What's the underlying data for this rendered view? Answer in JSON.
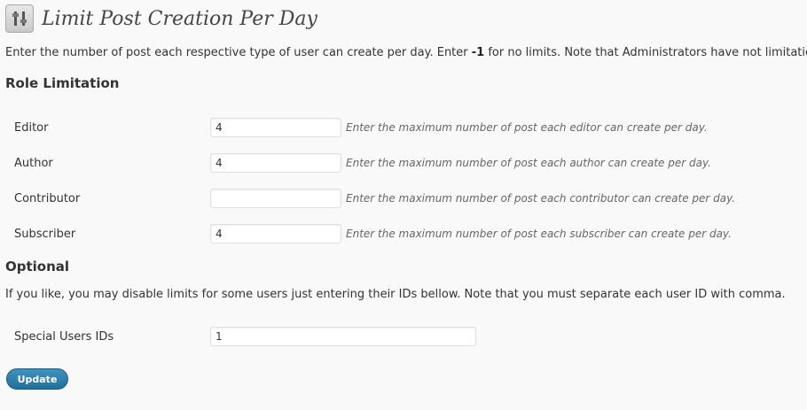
{
  "header": {
    "icon": "settings-icon",
    "title": "Limit Post Creation Per Day"
  },
  "intro": {
    "before": "Enter the number of post each respective type of user can create per day. Enter ",
    "highlight": "-1",
    "after": " for no limits. Note that Administrators have not limitations."
  },
  "role_section": {
    "heading": "Role Limitation",
    "rows": [
      {
        "label": "Editor",
        "value": "4",
        "description": "Enter the maximum number of post each editor can create per day."
      },
      {
        "label": "Author",
        "value": "4",
        "description": "Enter the maximum number of post each author can create per day."
      },
      {
        "label": "Contributor",
        "value": "",
        "description": "Enter the maximum number of post each contributor can create per day."
      },
      {
        "label": "Subscriber",
        "value": "4",
        "description": "Enter the maximum number of post each subscriber can create per day."
      }
    ]
  },
  "optional_section": {
    "heading": "Optional",
    "note": "If you like, you may disable limits for some users just entering their IDs bellow. Note that you must separate each user ID with comma.",
    "special_label": "Special Users IDs",
    "special_value": "1"
  },
  "actions": {
    "update_label": "Update"
  }
}
